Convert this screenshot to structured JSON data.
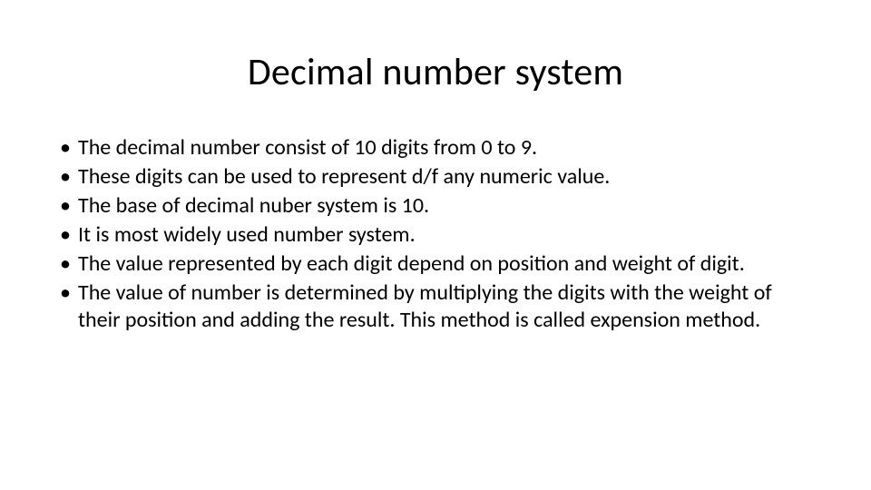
{
  "slide": {
    "title": "Decimal number system",
    "bullets": [
      "The decimal number consist of 10 digits from 0 to 9.",
      "These digits can be used to represent d/f any numeric value.",
      "The base of decimal nuber system is 10.",
      "It is most widely used number system.",
      "The value represented by each digit depend on position and weight of digit.",
      "The value of number is determined by multiplying the digits with the weight of their position and adding the result. This method is called expension method."
    ]
  }
}
